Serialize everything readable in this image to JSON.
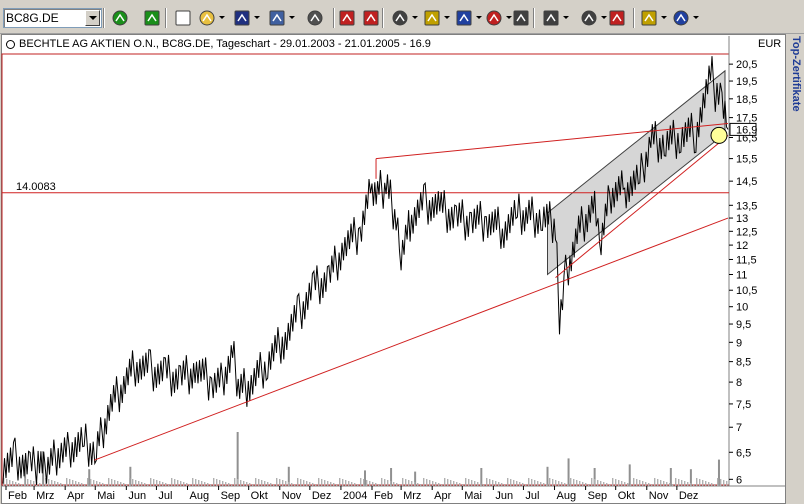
{
  "toolbar": {
    "symbol_value": "BC8G.DE",
    "buttons": [
      {
        "name": "refresh-icon",
        "x": 111,
        "color": "#1a8f1a",
        "drop": false
      },
      {
        "name": "reload-icon",
        "x": 143,
        "color": "#1a8f1a",
        "drop": false
      },
      {
        "name": "new-document-icon",
        "x": 174,
        "color": "#ffffff",
        "drop": false
      },
      {
        "name": "open-folder-icon",
        "x": 198,
        "color": "#e8c040",
        "drop": true
      },
      {
        "name": "save-icon",
        "x": 233,
        "color": "#203080",
        "drop": true
      },
      {
        "name": "copy-icon",
        "x": 268,
        "color": "#4060a0",
        "drop": true
      },
      {
        "name": "print-icon",
        "x": 306,
        "color": "#505050",
        "drop": false
      },
      {
        "name": "back-icon",
        "x": 338,
        "color": "#c02020",
        "drop": false
      },
      {
        "name": "forward-icon",
        "x": 362,
        "color": "#c02020",
        "drop": false
      },
      {
        "name": "window-icon",
        "x": 391,
        "color": "#404040",
        "drop": true
      },
      {
        "name": "indicator-icon",
        "x": 423,
        "color": "#c0a000",
        "drop": true
      },
      {
        "name": "chart-type-icon",
        "x": 455,
        "color": "#2040a0",
        "drop": true
      },
      {
        "name": "sigma-icon",
        "x": 485,
        "color": "#c02020",
        "drop": true
      },
      {
        "name": "properties-icon",
        "x": 512,
        "color": "#404040",
        "drop": false
      },
      {
        "name": "drawing-line-icon",
        "x": 542,
        "color": "#404040",
        "drop": true
      },
      {
        "name": "cursor-icon",
        "x": 580,
        "color": "#404040",
        "drop": true
      },
      {
        "name": "magnet-icon",
        "x": 608,
        "color": "#c02020",
        "drop": false
      },
      {
        "name": "settings-icon",
        "x": 640,
        "color": "#c0a000",
        "drop": true
      },
      {
        "name": "rotate-icon",
        "x": 672,
        "color": "#2040a0",
        "drop": true
      }
    ]
  },
  "side_panel": {
    "label": "Top-Zertifikate"
  },
  "chart_header": {
    "title": "BECHTLE AG AKTIEN O.N., BC8G.DE, Tageschart - 29.01.2003 - 21.01.2005 - 16.9",
    "currency": "EUR"
  },
  "colors": {
    "price": "#000000",
    "trendline": "#d02020",
    "channel_fill": "#c8c8c8",
    "volume": "#909090",
    "level_line": "#d02020",
    "price_marker": "#ffff99"
  },
  "chart_data": {
    "type": "line",
    "title": "BECHTLE AG AKTIEN O.N., BC8G.DE, Tageschart - 29.01.2003 - 21.01.2005 - 16.9",
    "x_range": [
      "2003-01-29",
      "2005-01-21"
    ],
    "x_ticks": [
      "Feb",
      "Mrz",
      "Apr",
      "Mai",
      "Jun",
      "Jul",
      "Aug",
      "Sep",
      "Okt",
      "Nov",
      "Dez",
      "2004",
      "Feb",
      "Mrz",
      "Apr",
      "Mai",
      "Jun",
      "Jul",
      "Aug",
      "Sep",
      "Okt",
      "Nov",
      "Dez"
    ],
    "x_tick_dates": [
      "2003-02-01",
      "2003-03-01",
      "2003-04-01",
      "2003-05-01",
      "2003-06-01",
      "2003-07-01",
      "2003-08-01",
      "2003-09-01",
      "2003-10-01",
      "2003-11-01",
      "2003-12-01",
      "2004-01-01",
      "2004-02-01",
      "2004-03-01",
      "2004-04-01",
      "2004-05-01",
      "2004-06-01",
      "2004-07-01",
      "2004-08-01",
      "2004-09-01",
      "2004-10-01",
      "2004-11-01",
      "2004-12-01"
    ],
    "y_ticks": [
      "20,5",
      "19,5",
      "18,5",
      "17,5",
      "16,5",
      "15,5",
      "14,5",
      "13,5",
      "13",
      "12,5",
      "12",
      "11,5",
      "11",
      "10,5",
      "10",
      "9,5",
      "9",
      "8,5",
      "8",
      "7,5",
      "7",
      "6,5",
      "6"
    ],
    "y_tick_values": [
      20.5,
      19.5,
      18.5,
      17.5,
      16.5,
      15.5,
      14.5,
      13.5,
      13,
      12.5,
      12,
      11.5,
      11,
      10.5,
      10,
      9.5,
      9,
      8.5,
      8,
      7.5,
      7,
      6.5,
      6
    ],
    "ylim": [
      5.9,
      21
    ],
    "log_scale": true,
    "grid": false,
    "last_price": 16.9,
    "last_price_label": "16,9",
    "level_line": {
      "value": 14.0083,
      "label": "14.0083"
    },
    "series": [
      {
        "dates": [
          "2003-01-29",
          "2003-02-10",
          "2003-02-25",
          "2003-03-05",
          "2003-03-12",
          "2003-03-25",
          "2003-04-05",
          "2003-04-20",
          "2003-05-02",
          "2003-05-15",
          "2003-05-28",
          "2003-06-10",
          "2003-06-25",
          "2003-07-10",
          "2003-07-25",
          "2003-08-10",
          "2003-08-25",
          "2003-09-05",
          "2003-09-15",
          "2003-09-22",
          "2003-10-05",
          "2003-10-20",
          "2003-11-05",
          "2003-11-20",
          "2003-12-05",
          "2003-12-20",
          "2004-01-05",
          "2004-01-20",
          "2004-02-01",
          "2004-02-08",
          "2004-02-15",
          "2004-02-25",
          "2004-03-01",
          "2004-03-10",
          "2004-03-25",
          "2004-04-10",
          "2004-04-25",
          "2004-05-10",
          "2004-05-25",
          "2004-06-10",
          "2004-06-25",
          "2004-07-05",
          "2004-07-20",
          "2004-08-02",
          "2004-08-06",
          "2004-08-12",
          "2004-08-25",
          "2004-09-10",
          "2004-09-15",
          "2004-09-25",
          "2004-10-10",
          "2004-10-25",
          "2004-11-05",
          "2004-11-20",
          "2004-12-05",
          "2004-12-20",
          "2005-01-05",
          "2005-01-10",
          "2005-01-15",
          "2005-01-21"
        ],
        "values": [
          6.3,
          6.4,
          6.2,
          6.3,
          6.1,
          6.5,
          6.6,
          6.7,
          6.5,
          7.4,
          7.9,
          8.4,
          8.3,
          8.2,
          8.1,
          8.3,
          8.0,
          8.1,
          8.7,
          7.8,
          8.0,
          8.5,
          9.1,
          9.8,
          10.6,
          10.9,
          12.0,
          12.5,
          14.4,
          14.1,
          14.3,
          13.0,
          11.7,
          12.9,
          13.6,
          13.4,
          13.0,
          12.9,
          12.9,
          12.6,
          13.2,
          13.1,
          13.0,
          12.8,
          9.8,
          11.0,
          12.5,
          13.6,
          11.8,
          13.8,
          14.2,
          14.6,
          16.4,
          16.2,
          16.6,
          16.8,
          19.8,
          18.5,
          18.2,
          16.9
        ]
      }
    ],
    "volume": {
      "dates": [
        "2003-02-20",
        "2003-03-10",
        "2003-04-25",
        "2003-06-05",
        "2003-09-20",
        "2003-11-10",
        "2004-01-25",
        "2004-02-20",
        "2004-03-15",
        "2004-05-20",
        "2004-07-25",
        "2004-08-15",
        "2004-09-10",
        "2004-10-15",
        "2004-11-25",
        "2004-12-15",
        "2005-01-12"
      ],
      "values": [
        2.2,
        2.9,
        1.4,
        1.6,
        4.5,
        1.6,
        1.3,
        1.5,
        1.2,
        1.5,
        1.6,
        2.3,
        1.5,
        1.8,
        1.5,
        1.4,
        2.2
      ]
    },
    "trendlines": [
      {
        "name": "support-trendline-long",
        "from": [
          "2003-04-30",
          6.35
        ],
        "to": [
          "2005-01-21",
          13.0
        ]
      },
      {
        "name": "support-trendline-short",
        "from": [
          "2004-08-02",
          10.9
        ],
        "to": [
          "2005-01-21",
          16.6
        ]
      },
      {
        "name": "resistance-trendline",
        "from": [
          "2004-02-05",
          15.5
        ],
        "to": [
          "2005-01-21",
          17.2
        ]
      }
    ],
    "channel": {
      "upper_from": [
        "2004-07-25",
        13.2
      ],
      "upper_to": [
        "2005-01-18",
        20.1
      ],
      "lower_from": [
        "2004-07-25",
        11.0
      ],
      "lower_to": [
        "2005-01-18",
        16.7
      ]
    }
  }
}
